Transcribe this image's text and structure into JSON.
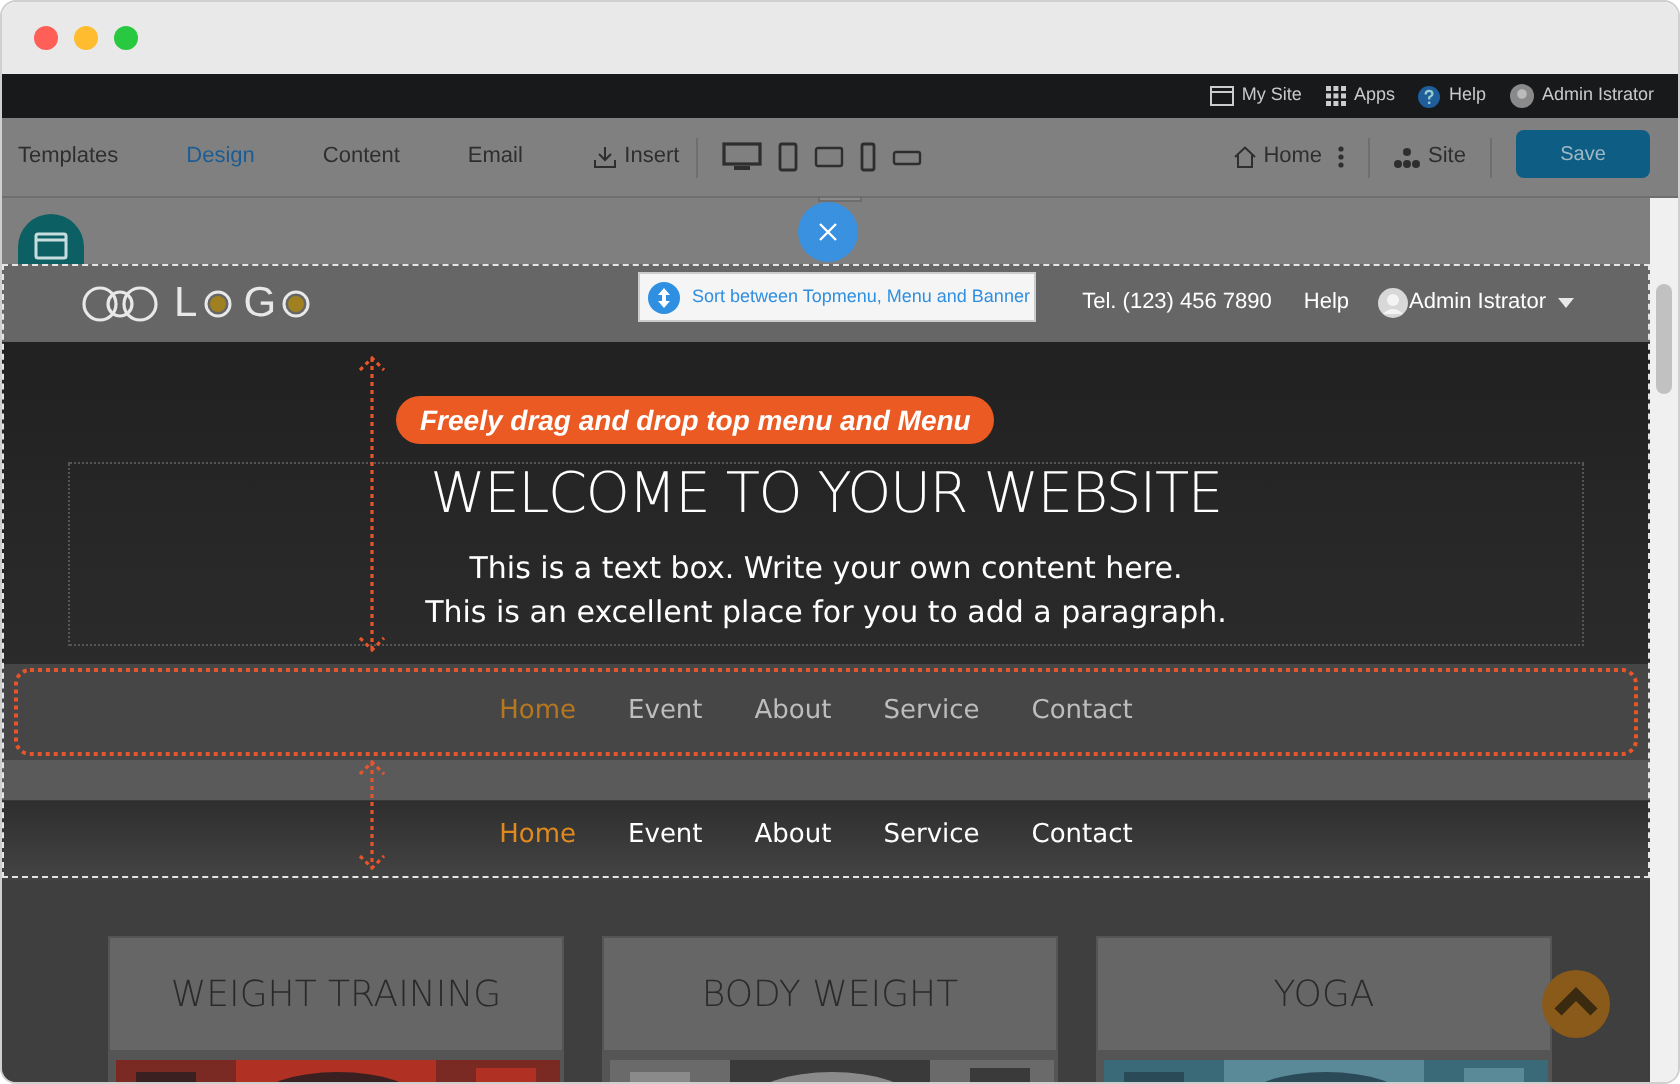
{
  "top_bar": [
    {
      "kind": "window",
      "label": "My Site"
    },
    {
      "kind": "apps",
      "label": "Apps"
    },
    {
      "kind": "help",
      "label": "Help"
    },
    {
      "kind": "user",
      "label": "Admin Istrator"
    }
  ],
  "toolbar": {
    "tabs": [
      {
        "label": "Templates",
        "selected": false
      },
      {
        "label": "Design",
        "selected": true
      },
      {
        "label": "Content",
        "selected": false
      },
      {
        "label": "Email",
        "selected": false
      }
    ],
    "insert": "Insert",
    "home": "Home",
    "site": "Site",
    "save": "Save"
  },
  "tooltip": "Sort between Topmenu, Menu and Banner",
  "annotation": "Freely drag and drop top menu and Menu",
  "site_header": {
    "logo_letters": [
      "L",
      "G"
    ],
    "phone": "Tel. (123) 456 7890",
    "help": "Help",
    "user": "Admin Istrator"
  },
  "hero": {
    "title": "WELCOME TO YOUR WEBSITE",
    "lines": [
      "This is a text box. Write your own content here.",
      "This is an excellent place for you to add a paragraph."
    ]
  },
  "menus": [
    [
      {
        "label": "Home",
        "selected": true
      },
      {
        "label": "Event",
        "selected": false
      },
      {
        "label": "About",
        "selected": false
      },
      {
        "label": "Service",
        "selected": false
      },
      {
        "label": "Contact",
        "selected": false
      }
    ],
    [
      {
        "label": "Home",
        "selected": true
      },
      {
        "label": "Event",
        "selected": false
      },
      {
        "label": "About",
        "selected": false
      },
      {
        "label": "Service",
        "selected": false
      },
      {
        "label": "Contact",
        "selected": false
      }
    ]
  ],
  "cards": [
    {
      "title": "WEIGHT TRAINING"
    },
    {
      "title": "BODY WEIGHT"
    },
    {
      "title": "YOGA"
    }
  ]
}
